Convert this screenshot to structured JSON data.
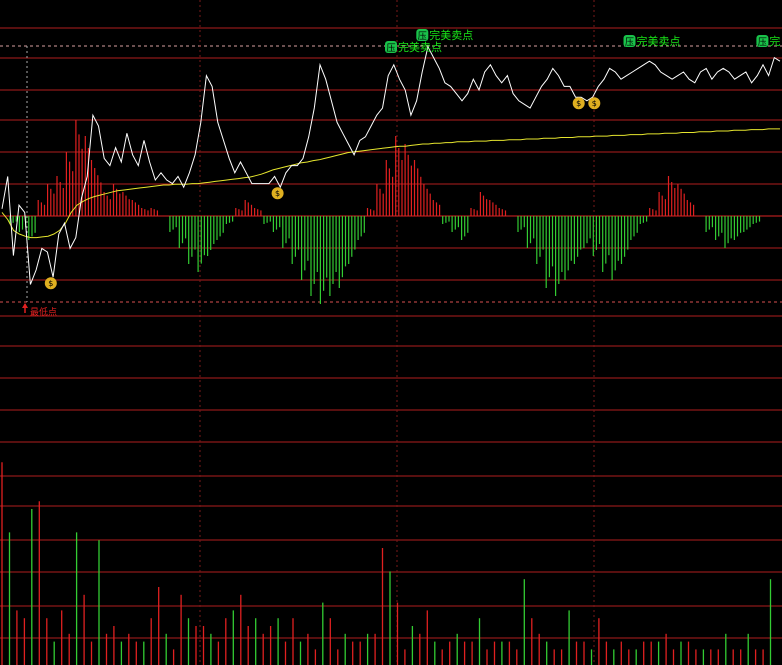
{
  "chart_data": {
    "type": "line",
    "title": "",
    "xlabel": "",
    "ylabel": "",
    "grid": true,
    "colors": {
      "background": "#000000",
      "grid": "#b01e1e",
      "grid_vertical": "#7a1a1a",
      "price_line": "#ffffff",
      "avg_line": "#e6e62e",
      "bar_up": "#e02020",
      "bar_down": "#33cc33",
      "bar_dotted_up": "#26a0a0",
      "badge": "#19c34a",
      "money_icon": "#e0b020"
    },
    "series": [
      {
        "role": "price",
        "values": [
          0.1,
          0.55,
          -0.55,
          0.15,
          0.05,
          -0.95,
          -0.75,
          -0.45,
          -0.5,
          -0.85,
          -0.25,
          -0.1,
          -0.45,
          -0.3,
          0.25,
          0.55,
          1.4,
          1.25,
          0.8,
          0.7,
          0.95,
          0.75,
          1.15,
          0.85,
          0.7,
          1.05,
          0.75,
          0.5,
          0.6,
          0.5,
          0.45,
          0.55,
          0.4,
          0.6,
          0.85,
          1.3,
          1.95,
          1.8,
          1.3,
          1.05,
          0.8,
          0.6,
          0.75,
          0.6,
          0.45,
          0.45,
          0.45,
          0.45,
          0.55,
          0.4,
          0.6,
          0.7,
          0.7,
          0.8,
          1.1,
          1.5,
          2.1,
          1.9,
          1.6,
          1.3,
          1.15,
          1.0,
          0.85,
          1.05,
          1.1,
          1.25,
          1.4,
          1.5,
          1.95,
          2.1,
          1.9,
          1.75,
          1.4,
          1.6,
          2.0,
          2.35,
          2.2,
          2.05,
          1.85,
          1.8,
          1.7,
          1.6,
          1.7,
          1.9,
          1.75,
          2.0,
          2.1,
          1.95,
          1.85,
          1.95,
          1.7,
          1.6,
          1.55,
          1.5,
          1.65,
          1.8,
          1.9,
          2.05,
          1.95,
          1.8,
          1.8,
          1.65,
          1.65,
          1.6,
          1.65,
          1.8,
          1.9,
          2.05,
          2.0,
          1.9,
          1.95,
          2.0,
          2.05,
          2.1,
          2.15,
          2.1,
          2.0,
          1.95,
          1.9,
          1.95,
          2.0,
          1.9,
          1.85,
          2.0,
          2.05,
          1.9,
          2.0,
          2.05,
          2.0,
          1.9,
          1.95,
          2.0,
          1.85,
          1.95,
          2.1,
          1.95,
          2.2,
          2.15
        ]
      },
      {
        "role": "average",
        "values": [
          0.05,
          -0.05,
          -0.2,
          -0.25,
          -0.28,
          -0.3,
          -0.3,
          -0.29,
          -0.28,
          -0.25,
          -0.2,
          -0.1,
          0.05,
          0.15,
          0.2,
          0.24,
          0.27,
          0.29,
          0.31,
          0.33,
          0.35,
          0.36,
          0.37,
          0.38,
          0.39,
          0.4,
          0.41,
          0.42,
          0.43,
          0.43,
          0.44,
          0.44,
          0.44,
          0.45,
          0.45,
          0.46,
          0.47,
          0.48,
          0.49,
          0.5,
          0.51,
          0.52,
          0.53,
          0.54,
          0.56,
          0.58,
          0.61,
          0.64,
          0.66,
          0.68,
          0.7,
          0.72,
          0.74,
          0.75,
          0.77,
          0.78,
          0.8,
          0.82,
          0.84,
          0.86,
          0.88,
          0.89,
          0.9,
          0.91,
          0.92,
          0.93,
          0.94,
          0.95,
          0.96,
          0.97,
          0.97,
          0.98,
          0.99,
          1.0,
          1.0,
          1.01,
          1.01,
          1.02,
          1.02,
          1.03,
          1.03,
          1.03,
          1.04,
          1.04,
          1.04,
          1.05,
          1.05,
          1.05,
          1.06,
          1.06,
          1.06,
          1.07,
          1.07,
          1.07,
          1.08,
          1.08,
          1.08,
          1.09,
          1.09,
          1.09,
          1.1,
          1.1,
          1.1,
          1.11,
          1.11,
          1.11,
          1.12,
          1.12,
          1.12,
          1.13,
          1.13,
          1.13,
          1.14,
          1.14,
          1.14,
          1.15,
          1.15,
          1.15,
          1.16,
          1.16,
          1.16,
          1.17,
          1.17,
          1.17,
          1.18,
          1.18,
          1.18,
          1.19,
          1.19,
          1.19,
          1.2,
          1.2,
          1.2,
          1.21,
          1.21,
          1.21
        ]
      },
      {
        "role": "signal_bars",
        "values": [
          -0.1,
          -0.2,
          -0.3,
          0.2,
          0.4,
          0.5,
          0.8,
          1.2,
          1.0,
          0.6,
          0.3,
          0.4,
          0.3,
          0.2,
          0.1,
          0.1,
          0.0,
          -0.2,
          -0.4,
          -0.6,
          -0.7,
          -0.5,
          -0.3,
          -0.1,
          0.1,
          0.2,
          0.1,
          -0.1,
          -0.2,
          -0.4,
          -0.6,
          -0.8,
          -1.0,
          -1.1,
          -1.0,
          -0.9,
          -0.6,
          -0.3,
          0.1,
          0.4,
          0.7,
          1.0,
          0.9,
          0.7,
          0.4,
          0.2,
          -0.1,
          -0.2,
          -0.3,
          0.1,
          0.3,
          0.2,
          0.1,
          0.0,
          -0.2,
          -0.4,
          -0.6,
          -0.9,
          -1.0,
          -0.8,
          -0.6,
          -0.4,
          -0.5,
          -0.7,
          -0.8,
          -0.6,
          -0.3,
          -0.1,
          0.1,
          0.3,
          0.5,
          0.4,
          0.2,
          0.0,
          -0.2,
          -0.3,
          -0.4,
          -0.3,
          -0.2,
          -0.1,
          0.0
        ]
      },
      {
        "role": "volume",
        "values": [
          2.6,
          1.7,
          0.7,
          0.6,
          2.0,
          2.1,
          0.6,
          0.3,
          0.7,
          0.4,
          1.7,
          0.9,
          0.3,
          1.6,
          0.4,
          0.5,
          0.3,
          0.4,
          0.3,
          0.3,
          0.6,
          1.0,
          0.4,
          0.2,
          0.9,
          0.6,
          0.5,
          0.5,
          0.4,
          0.3,
          0.6,
          0.7,
          0.9,
          0.5,
          0.6,
          0.4,
          0.5,
          0.6,
          0.3,
          0.6,
          0.3,
          0.4,
          0.2,
          0.8,
          0.6,
          0.2,
          0.4,
          0.3,
          0.3,
          0.4,
          0.4,
          1.5,
          1.2,
          0.8,
          0.2,
          0.5,
          0.4,
          0.7,
          0.3,
          0.2,
          0.3,
          0.4,
          0.3,
          0.3,
          0.6,
          0.2,
          0.3,
          0.3,
          0.3,
          0.2,
          1.1,
          0.6,
          0.4,
          0.3,
          0.2,
          0.2,
          0.7,
          0.3,
          0.3,
          0.2,
          0.6,
          0.3,
          0.2,
          0.3,
          0.2,
          0.2,
          0.3,
          0.3,
          0.3,
          0.4,
          0.2,
          0.3,
          0.3,
          0.2,
          0.2,
          0.2,
          0.2,
          0.4,
          0.2,
          0.2,
          0.4,
          0.2,
          0.2,
          1.1
        ]
      }
    ],
    "signals": [
      {
        "kind": "sell",
        "text": "完美卖点",
        "badge": "压",
        "at": 0.5
      },
      {
        "kind": "sell",
        "text": "完美卖点",
        "badge": "压",
        "at": 0.54
      },
      {
        "kind": "sell",
        "text": "完美卖点",
        "badge": "压",
        "at": 0.805
      },
      {
        "kind": "sell",
        "text": "完",
        "badge": "压",
        "at": 0.975
      },
      {
        "kind": "buy",
        "text": "",
        "badge": "$",
        "at": 0.065
      },
      {
        "kind": "buy",
        "text": "",
        "badge": "$",
        "at": 0.355
      },
      {
        "kind": "buy",
        "text": "",
        "badge": "$",
        "at": 0.74
      },
      {
        "kind": "buy",
        "text": "",
        "badge": "$",
        "at": 0.76
      }
    ],
    "low_marker": {
      "text": "最低点",
      "at": 0.032
    }
  }
}
